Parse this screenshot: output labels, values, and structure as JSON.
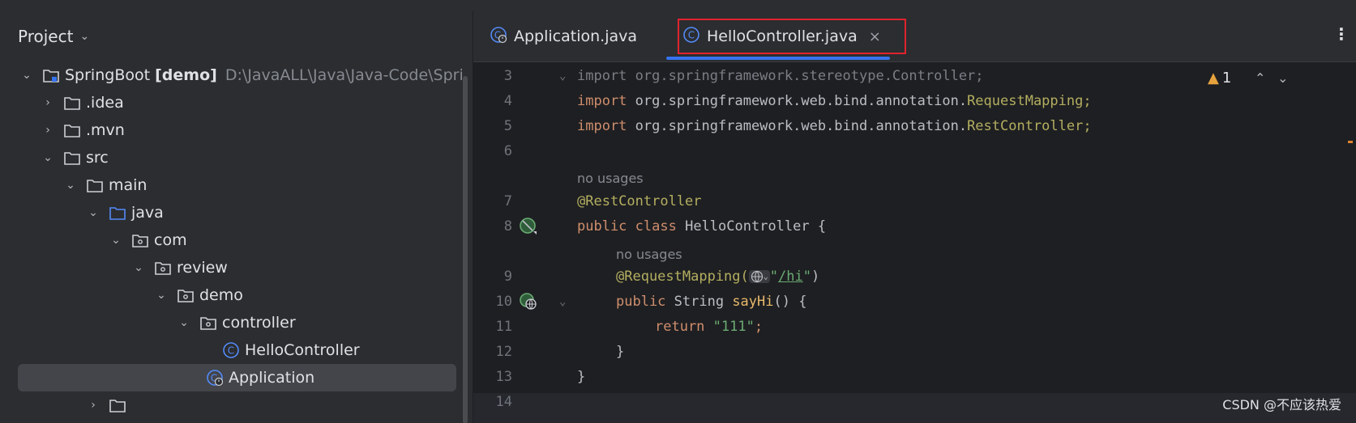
{
  "project_panel": {
    "title": "Project",
    "tree": [
      {
        "label": "SpringBoot",
        "bold_suffix": "[demo]",
        "path": "D:\\JavaALL\\Java\\Java-Code\\Spri",
        "icon": "module-folder-icon"
      },
      {
        "label": ".idea",
        "icon": "folder-icon"
      },
      {
        "label": ".mvn",
        "icon": "folder-icon"
      },
      {
        "label": "src",
        "icon": "folder-icon"
      },
      {
        "label": "main",
        "icon": "folder-icon"
      },
      {
        "label": "java",
        "icon": "source-folder-icon"
      },
      {
        "label": "com",
        "icon": "package-icon"
      },
      {
        "label": "review",
        "icon": "package-icon"
      },
      {
        "label": "demo",
        "icon": "package-icon"
      },
      {
        "label": "controller",
        "icon": "package-icon"
      },
      {
        "label": "HelloController",
        "icon": "class-icon"
      },
      {
        "label": "Application",
        "icon": "spring-boot-class-icon"
      }
    ]
  },
  "editor": {
    "tabs": [
      {
        "label": "Application.java",
        "icon": "spring-boot-class-icon",
        "active": false
      },
      {
        "label": "HelloController.java",
        "icon": "class-icon",
        "active": true,
        "close": "×"
      }
    ],
    "more_icon": "⋮",
    "warning_count": "1",
    "lines": {
      "l3": {
        "num": "3",
        "pre": "import ",
        "pkg": "org.springframework.stereotype.Controller;"
      },
      "l4": {
        "num": "4",
        "pre": "import ",
        "pkg": "org.springframework.web.bind.annotation.",
        "cls": "RequestMapping;"
      },
      "l5": {
        "num": "5",
        "pre": "import ",
        "pkg": "org.springframework.web.bind.annotation.",
        "cls": "RestController;"
      },
      "l6": {
        "num": "6"
      },
      "usages1": "no usages",
      "l7": {
        "num": "7",
        "ann": "@RestController"
      },
      "l8": {
        "num": "8",
        "kw1": "public",
        "kw2": "class",
        "name": " HelloController {"
      },
      "usages2": "no usages",
      "l9": {
        "num": "9",
        "ann": "@RequestMapping(",
        "str_open": "\"",
        "str": "/hi",
        "str_close": "\"",
        "close": ")"
      },
      "l10": {
        "num": "10",
        "kw": "public",
        "type": " String ",
        "fn": "sayHi",
        "rest": "() {"
      },
      "l11": {
        "num": "11",
        "kw": "return",
        "str": "\"111\"",
        "semi": ";"
      },
      "l12": {
        "num": "12",
        "text": "}"
      },
      "l13": {
        "num": "13",
        "text": "}"
      },
      "l14": {
        "num": "14"
      }
    }
  },
  "watermark": "CSDN @不应该热爱"
}
